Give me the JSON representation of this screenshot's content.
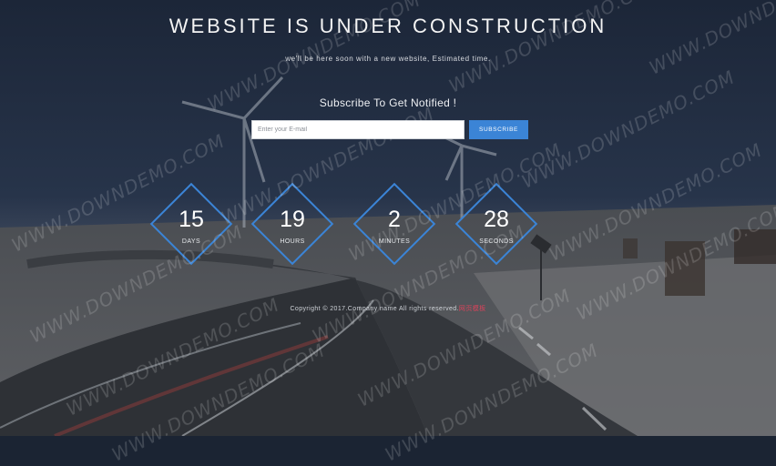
{
  "headline": "WEBSITE IS UNDER CONSTRUCTION",
  "tagline": "we'll be here soon with a new website, Estimated time.",
  "subscribe": {
    "title": "Subscribe To Get Notified !",
    "email_placeholder": "Enter your E-mail",
    "button_label": "SUBSCRIBE"
  },
  "countdown": [
    {
      "value": "15",
      "unit": "DAYS"
    },
    {
      "value": "19",
      "unit": "HOURS"
    },
    {
      "value": "2",
      "unit": "MINUTES"
    },
    {
      "value": "28",
      "unit": "SECONDS"
    }
  ],
  "footer": {
    "copyright": "Copyright © 2017.Company name All rights reserved.",
    "link_text": "网页模板"
  },
  "watermark_text": "WWW.DOWNDEMO.COM",
  "colors": {
    "accent": "#3b84d6",
    "footer_link": "#d9435b"
  }
}
